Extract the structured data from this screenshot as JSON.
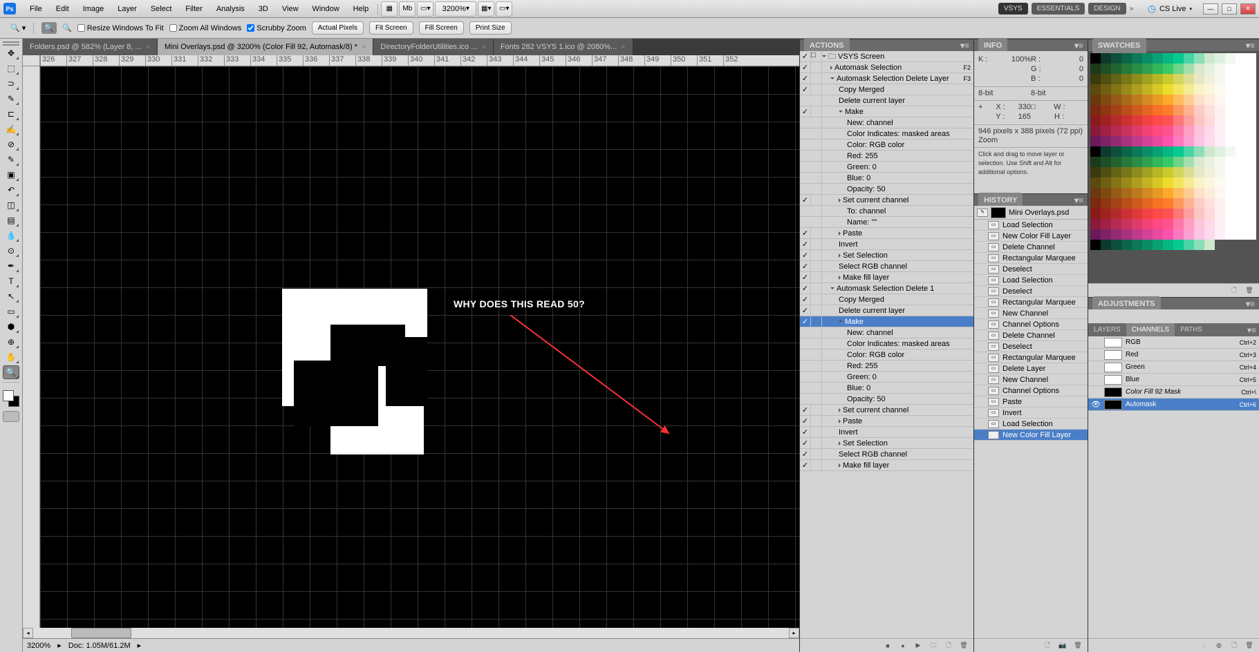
{
  "menu": {
    "items": [
      "File",
      "Edit",
      "Image",
      "Layer",
      "Select",
      "Filter",
      "Analysis",
      "3D",
      "View",
      "Window",
      "Help"
    ],
    "zoom": "3200%",
    "ws_vsys": "VSYS",
    "ws_essentials": "ESSENTIALS",
    "ws_design": "DESIGN",
    "cslive": "CS Live"
  },
  "options": {
    "resize": "Resize Windows To Fit",
    "zoomall": "Zoom All Windows",
    "scrubby": "Scrubby Zoom",
    "actual": "Actual Pixels",
    "fitscreen": "Fit Screen",
    "fillscreen": "Fill Screen",
    "printsize": "Print Size"
  },
  "tabs": [
    {
      "label": "Folders.psd @ 582% (Layer 8, ...",
      "active": false
    },
    {
      "label": "Mini Overlays.psd @ 3200% (Color Fill 92, Automask/8) *",
      "active": true
    },
    {
      "label": "DirectoryFolderUtilities.ico ...",
      "active": false
    },
    {
      "label": "Fonts 282 VSYS 1.ico @ 2080%...",
      "active": false
    }
  ],
  "ruler": [
    "326",
    "327",
    "328",
    "329",
    "330",
    "331",
    "332",
    "333",
    "334",
    "335",
    "336",
    "337",
    "338",
    "339",
    "340",
    "341",
    "342",
    "343",
    "344",
    "345",
    "346",
    "347",
    "348",
    "349",
    "350",
    "351",
    "352"
  ],
  "annotation": "WHY DOES THIS READ 50?",
  "status": {
    "zoom": "3200%",
    "doc": "Doc: 1.05M/61.2M"
  },
  "actions": {
    "title": "ACTIONS",
    "set": "VSYS Screen",
    "rows": [
      {
        "indent": 1,
        "arrow": "r",
        "label": "Automask Selection",
        "fkey": "F2",
        "chk": true
      },
      {
        "indent": 1,
        "arrow": "d",
        "label": "Automask Selection Delete Layer",
        "fkey": "F3",
        "chk": true
      },
      {
        "indent": 2,
        "arrow": "",
        "label": "Copy Merged",
        "chk": true
      },
      {
        "indent": 2,
        "arrow": "",
        "label": "Delete current layer"
      },
      {
        "indent": 2,
        "arrow": "d",
        "label": "Make",
        "chk": true
      },
      {
        "indent": 3,
        "arrow": "",
        "label": "New: channel"
      },
      {
        "indent": 3,
        "arrow": "",
        "label": "Color Indicates: masked areas"
      },
      {
        "indent": 3,
        "arrow": "",
        "label": "Color: RGB color"
      },
      {
        "indent": 3,
        "arrow": "",
        "label": "Red: 255"
      },
      {
        "indent": 3,
        "arrow": "",
        "label": "Green: 0"
      },
      {
        "indent": 3,
        "arrow": "",
        "label": "Blue: 0"
      },
      {
        "indent": 3,
        "arrow": "",
        "label": "Opacity: 50"
      },
      {
        "indent": 2,
        "arrow": "r",
        "label": "Set current channel",
        "chk": true
      },
      {
        "indent": 3,
        "arrow": "",
        "label": "To: channel"
      },
      {
        "indent": 3,
        "arrow": "",
        "label": "Name:  \"\""
      },
      {
        "indent": 2,
        "arrow": "r",
        "label": "Paste",
        "chk": true
      },
      {
        "indent": 2,
        "arrow": "",
        "label": "Invert",
        "chk": true
      },
      {
        "indent": 2,
        "arrow": "r",
        "label": "Set Selection",
        "chk": true
      },
      {
        "indent": 2,
        "arrow": "",
        "label": "Select RGB channel",
        "chk": true
      },
      {
        "indent": 2,
        "arrow": "r",
        "label": "Make fill layer",
        "chk": true
      },
      {
        "indent": 1,
        "arrow": "d",
        "label": "Automask Selection Delete 1",
        "chk": true
      },
      {
        "indent": 2,
        "arrow": "",
        "label": "Copy Merged",
        "chk": true
      },
      {
        "indent": 2,
        "arrow": "",
        "label": "Delete current layer",
        "chk": true
      },
      {
        "indent": 2,
        "arrow": "d",
        "label": "Make",
        "chk": true,
        "hl": true
      },
      {
        "indent": 3,
        "arrow": "",
        "label": "New: channel"
      },
      {
        "indent": 3,
        "arrow": "",
        "label": "Color Indicates: masked areas"
      },
      {
        "indent": 3,
        "arrow": "",
        "label": "Color: RGB color"
      },
      {
        "indent": 3,
        "arrow": "",
        "label": "Red: 255"
      },
      {
        "indent": 3,
        "arrow": "",
        "label": "Green: 0"
      },
      {
        "indent": 3,
        "arrow": "",
        "label": "Blue: 0"
      },
      {
        "indent": 3,
        "arrow": "",
        "label": "Opacity: 50"
      },
      {
        "indent": 2,
        "arrow": "r",
        "label": "Set current channel",
        "chk": true
      },
      {
        "indent": 2,
        "arrow": "r",
        "label": "Paste",
        "chk": true
      },
      {
        "indent": 2,
        "arrow": "",
        "label": "Invert",
        "chk": true
      },
      {
        "indent": 2,
        "arrow": "r",
        "label": "Set Selection",
        "chk": true
      },
      {
        "indent": 2,
        "arrow": "",
        "label": "Select RGB channel",
        "chk": true
      },
      {
        "indent": 2,
        "arrow": "r",
        "label": "Make fill layer",
        "chk": true
      }
    ]
  },
  "info": {
    "title": "INFO",
    "k": "K :",
    "kval": "100%",
    "r": "R :",
    "rval": "0",
    "g": "G :",
    "gval": "0",
    "b": "B :",
    "bval": "0",
    "bit": "8-bit",
    "bit2": "8-bit",
    "x": "X :",
    "xval": "330",
    "y": "Y :",
    "yval": "165",
    "w": "W :",
    "h": "H :",
    "dim": "946 pixels x 388 pixels (72 ppi)",
    "zoom": "Zoom",
    "tip": "Click and drag to move layer or selection.  Use Shift and Alt for additional options."
  },
  "history": {
    "title": "HISTORY",
    "head": "Mini Overlays.psd",
    "rows": [
      "Load Selection",
      "New Color Fill Layer",
      "Delete Channel",
      "Rectangular Marquee",
      "Deselect",
      "Load Selection",
      "Deselect",
      "Rectangular Marquee",
      "New Channel",
      "Channel Options",
      "Delete Channel",
      "Deselect",
      "Rectangular Marquee",
      "Delete Layer",
      "New Channel",
      "Channel Options",
      "Paste",
      "Invert",
      "Load Selection",
      "New Color Fill Layer"
    ],
    "selected": 19
  },
  "swatches": {
    "title": "SWATCHES"
  },
  "adjustments": {
    "title": "ADJUSTMENTS"
  },
  "channels": {
    "tabs": [
      "LAYERS",
      "CHANNELS",
      "PATHS"
    ],
    "active": 1,
    "rows": [
      {
        "name": "RGB",
        "key": "Ctrl+2",
        "color": "#fff"
      },
      {
        "name": "Red",
        "key": "Ctrl+3",
        "color": "#fff"
      },
      {
        "name": "Green",
        "key": "Ctrl+4",
        "color": "#fff"
      },
      {
        "name": "Blue",
        "key": "Ctrl+5",
        "color": "#fff"
      },
      {
        "name": "Color Fill 92 Mask",
        "key": "Ctrl+\\",
        "color": "#000",
        "italic": true
      },
      {
        "name": "Automask",
        "key": "Ctrl+6",
        "color": "#000",
        "selected": true,
        "vis": true
      }
    ]
  },
  "swatch_colors": [
    "#000000",
    "#0e3a2e",
    "#0d4f3c",
    "#0c644a",
    "#0b7858",
    "#0a8d66",
    "#09a174",
    "#08b682",
    "#07ca90",
    "#49d4a4",
    "#8bdeb8",
    "#cde8cc",
    "#e0f0e0",
    "#f0f8f0",
    "#ffffff",
    "#ffffff",
    "#1a3a1a",
    "#1e4f25",
    "#226430",
    "#26783b",
    "#2a8d46",
    "#2ea151",
    "#32b65c",
    "#36ca67",
    "#6dd48a",
    "#a4dead",
    "#dbe8d0",
    "#e8f0e0",
    "#f4f8f0",
    "#ffffff",
    "#ffffff",
    "#ffffff",
    "#3a3a0e",
    "#4f4f12",
    "#646416",
    "#78781a",
    "#8d8d1e",
    "#a1a122",
    "#b6b626",
    "#caca2a",
    "#d4d45e",
    "#dede92",
    "#e8e8c6",
    "#f0f0dc",
    "#f8f8f0",
    "#ffffff",
    "#ffffff",
    "#ffffff",
    "#5a4a0e",
    "#6f5f12",
    "#847416",
    "#99891a",
    "#ae9e1e",
    "#c3b322",
    "#d8c826",
    "#eddd2a",
    "#f1e45e",
    "#f5eb92",
    "#f9f2c6",
    "#fbf6dc",
    "#fdfaf0",
    "#ffffff",
    "#ffffff",
    "#ffffff",
    "#6a3a0e",
    "#7f4a12",
    "#945a16",
    "#a96a1a",
    "#be7a1e",
    "#d38a22",
    "#e89a26",
    "#fdaa2a",
    "#fdbc5e",
    "#fdce92",
    "#fde0c6",
    "#feecdc",
    "#fef6f0",
    "#ffffff",
    "#ffffff",
    "#ffffff",
    "#7a2a0e",
    "#8f3612",
    "#a44216",
    "#b94e1a",
    "#ce5a1e",
    "#e36622",
    "#f87226",
    "#fd7e2a",
    "#fd985e",
    "#fdb292",
    "#fdccc6",
    "#fee0dc",
    "#fef0f0",
    "#ffffff",
    "#ffffff",
    "#ffffff",
    "#8a1a1a",
    "#9f2222",
    "#b42a2a",
    "#c93232",
    "#de3a3a",
    "#f34242",
    "#fd4a4a",
    "#fd5252",
    "#fd7878",
    "#fd9e9e",
    "#fdc4c4",
    "#fedada",
    "#fef0f0",
    "#ffffff",
    "#ffffff",
    "#ffffff",
    "#8a1a3a",
    "#9f2246",
    "#b42a52",
    "#c9325e",
    "#de3a6a",
    "#f34276",
    "#fd4a82",
    "#fd528e",
    "#fd78a8",
    "#fd9ec2",
    "#fdc4dc",
    "#fedae8",
    "#fef0f4",
    "#ffffff",
    "#ffffff",
    "#ffffff",
    "#6a1a5a",
    "#7f2266",
    "#942a72",
    "#a9327e",
    "#be3a8a",
    "#d34296",
    "#e84aa2",
    "#fd52ae",
    "#fd78c0",
    "#fd9ed2",
    "#fdc4e4",
    "#fedaee",
    "#fef0f8",
    "#ffffff",
    "#ffffff",
    "#ffffff"
  ]
}
